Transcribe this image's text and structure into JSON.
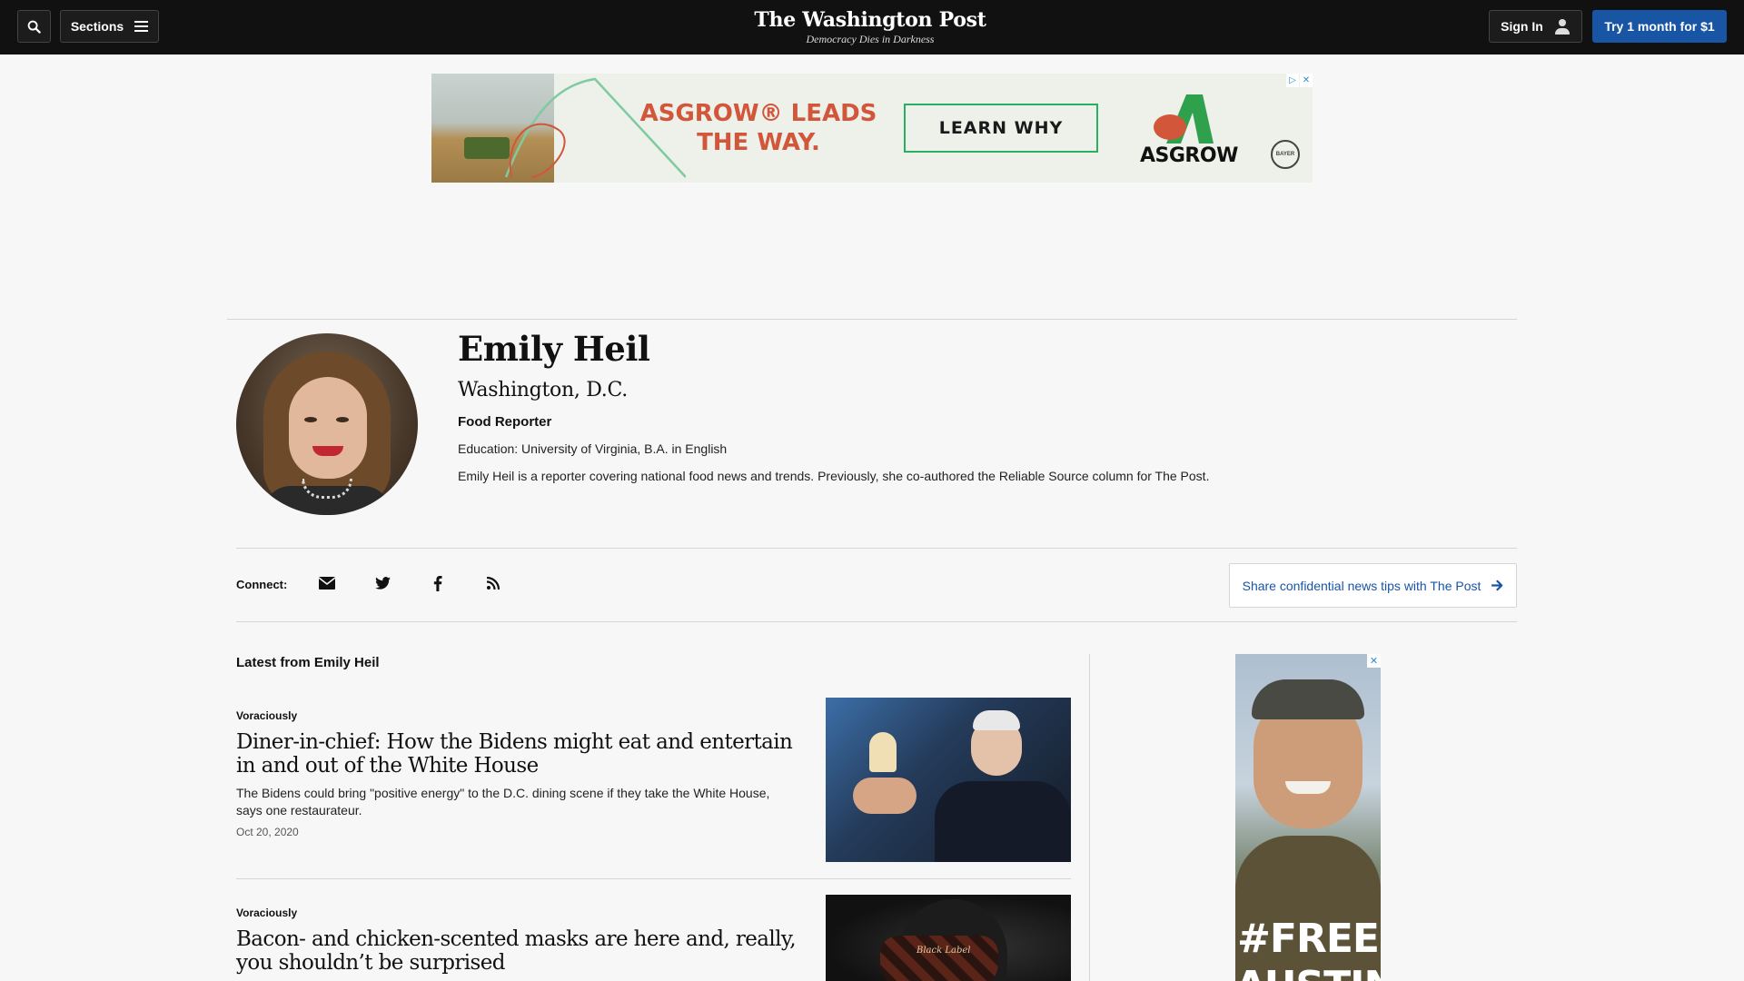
{
  "header": {
    "sections_label": "Sections",
    "brand_name": "The Washington Post",
    "tagline": "Democracy Dies in Darkness",
    "sign_in_label": "Sign In",
    "subscribe_label": "Try 1 month for $1"
  },
  "top_ad": {
    "headline_line1": "ASGROW® LEADS",
    "headline_line2": "THE WAY.",
    "cta_label": "LEARN WHY",
    "brand": "ASGROW",
    "sponsor_mark": "BAYER",
    "colors": {
      "accent": "#d2563a",
      "cta_border": "#27b062"
    }
  },
  "author": {
    "name": "Emily Heil",
    "location": "Washington, D.C.",
    "title": "Food Reporter",
    "education": "Education: University of Virginia, B.A. in English",
    "bio": "Emily Heil is a reporter covering national food news and trends. Previously, she co-authored the Reliable Source column for The Post."
  },
  "connect": {
    "label": "Connect:",
    "icons": [
      "email-icon",
      "twitter-icon",
      "facebook-icon",
      "rss-icon"
    ],
    "tips_label": "Share confidential news tips with The Post"
  },
  "latest": {
    "heading": "Latest from Emily Heil",
    "stories": [
      {
        "kicker": "Voraciously",
        "headline": "Diner-in-chief: How the Bidens might eat and entertain in and out of the White House",
        "blurb": "The Bidens could bring \"positive energy\" to the D.C. dining scene if they take the White House, says one restaurateur.",
        "date": "Oct 20, 2020"
      },
      {
        "kicker": "Voraciously",
        "headline": "Bacon- and chicken-scented masks are here and, really, you shouldn’t be surprised",
        "image_label": "Black Label"
      }
    ]
  },
  "side_ad": {
    "line1": "#FREE",
    "line2": "AUSTIN"
  },
  "colors": {
    "topbar": "#111111",
    "link_blue": "#1955a5",
    "page_bg": "#f7f7f7"
  }
}
